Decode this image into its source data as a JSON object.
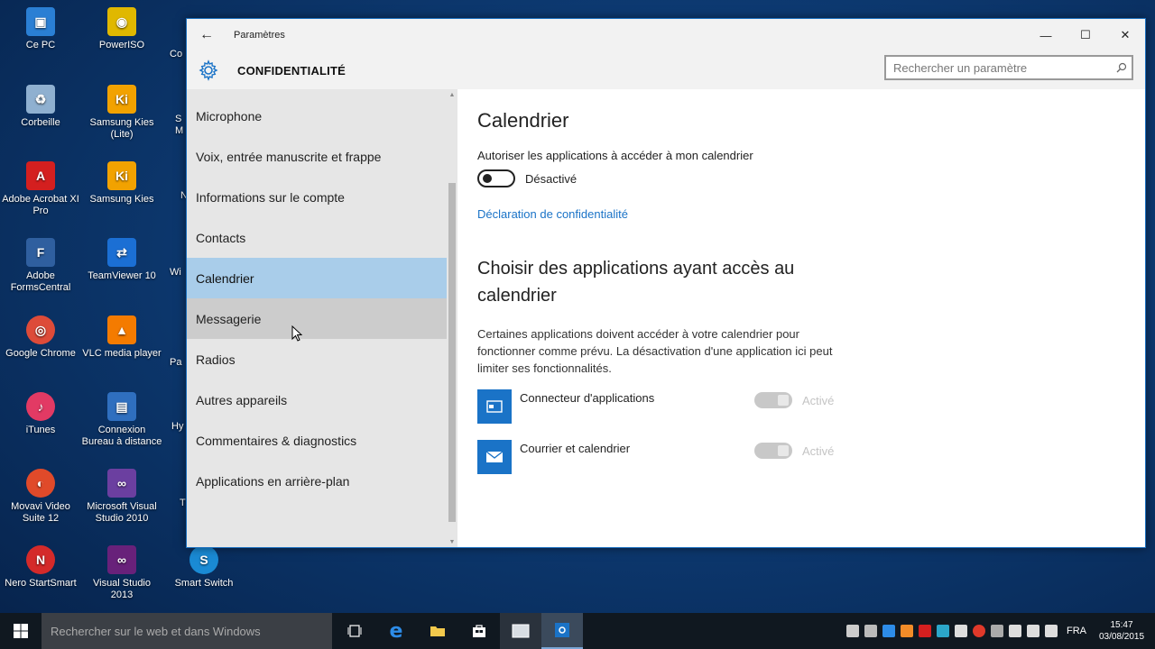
{
  "desktop": {
    "icons": [
      {
        "label": "Ce PC",
        "color": "#2a7fd4",
        "glyph": "▣"
      },
      {
        "label": "PowerISO",
        "color": "#e0b800",
        "glyph": "◉"
      },
      {
        "label": "Corbeille",
        "color": "#8fb0d0",
        "glyph": "♻"
      },
      {
        "label": "Samsung Kies (Lite)",
        "color": "#f2a200",
        "glyph": "Ki"
      },
      {
        "label": "Adobe Acrobat XI Pro",
        "color": "#d41f1f",
        "glyph": "A"
      },
      {
        "label": "Samsung Kies",
        "color": "#f2a200",
        "glyph": "Ki"
      },
      {
        "label": "Adobe FormsCentral",
        "color": "#2f5f9f",
        "glyph": "F"
      },
      {
        "label": "TeamViewer 10",
        "color": "#1b6fd4",
        "glyph": "⇄"
      },
      {
        "label": "Google Chrome",
        "color": "#dd4b39",
        "glyph": "◎"
      },
      {
        "label": "VLC media player",
        "color": "#f47b00",
        "glyph": "▲"
      },
      {
        "label": "iTunes",
        "color": "#e23a64",
        "glyph": "♪"
      },
      {
        "label": "Connexion Bureau à distance",
        "color": "#2f6fbf",
        "glyph": "▤"
      },
      {
        "label": "Movavi Video Suite 12",
        "color": "#e04a2a",
        "glyph": "◐"
      },
      {
        "label": "Microsoft Visual Studio 2010",
        "color": "#6b3fa0",
        "glyph": "∞"
      },
      {
        "label": "Nero StartSmart",
        "color": "#d42a2a",
        "glyph": "N"
      },
      {
        "label": "Visual Studio 2013",
        "color": "#68217a",
        "glyph": "∞"
      },
      {
        "label": "Smart Switch",
        "color": "#1a8ad4",
        "glyph": "S"
      }
    ],
    "partial_labels": [
      "Co",
      "S M",
      "N",
      "Wi",
      "Pa",
      "Hy",
      "T"
    ]
  },
  "window": {
    "title": "Paramètres",
    "back_icon": "←",
    "minimize": "—",
    "maximize": "☐",
    "close": "✕",
    "section_title": "CONFIDENTIALITÉ",
    "search_placeholder": "Rechercher un paramètre"
  },
  "sidebar": {
    "items": [
      {
        "label": "Microphone"
      },
      {
        "label": "Voix, entrée manuscrite et frappe"
      },
      {
        "label": "Informations sur le compte"
      },
      {
        "label": "Contacts"
      },
      {
        "label": "Calendrier"
      },
      {
        "label": "Messagerie"
      },
      {
        "label": "Radios"
      },
      {
        "label": "Autres appareils"
      },
      {
        "label": "Commentaires & diagnostics"
      },
      {
        "label": "Applications en arrière-plan"
      }
    ],
    "active_index": 4,
    "hover_index": 5
  },
  "content": {
    "heading": "Calendrier",
    "allow_label": "Autoriser les applications à accéder à mon calendrier",
    "toggle_state": "Désactivé",
    "privacy_link": "Déclaration de confidentialité",
    "choose_heading": "Choisir des applications ayant accès au calendrier",
    "description": "Certaines applications doivent accéder à votre calendrier pour fonctionner comme prévu. La désactivation d'une application ici peut limiter ses fonctionnalités.",
    "apps": [
      {
        "name": "Connecteur d'applications",
        "state": "Activé",
        "icon": "connector-icon"
      },
      {
        "name": "Courrier et calendrier",
        "state": "Activé",
        "icon": "mail-icon"
      }
    ]
  },
  "taskbar": {
    "search_placeholder": "Rechercher sur le web et dans Windows",
    "language": "FRA",
    "time": "15:47",
    "date": "03/08/2015"
  }
}
